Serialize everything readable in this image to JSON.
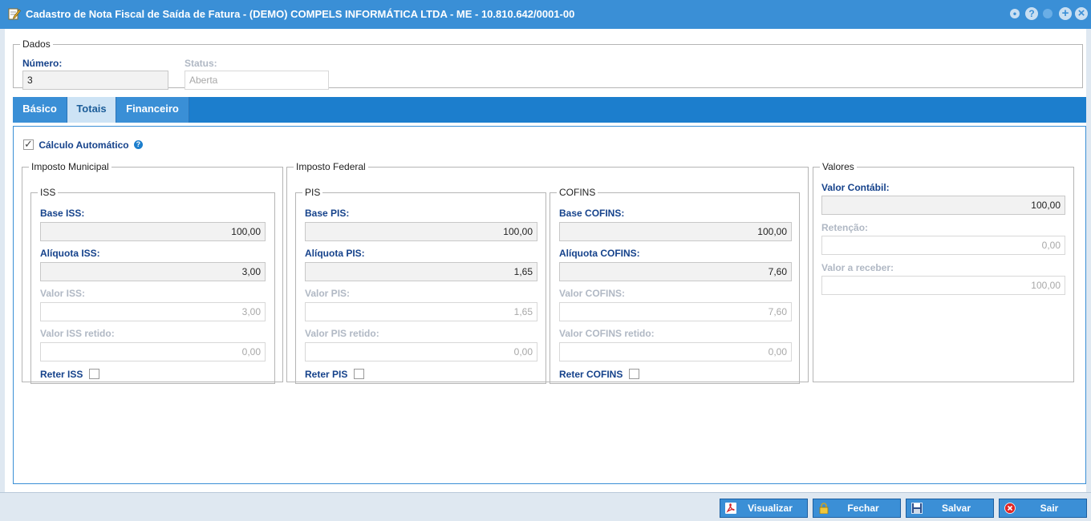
{
  "window": {
    "title": "Cadastro de Nota Fiscal de Saída de Fatura - (DEMO) COMPELS INFORMÁTICA LTDA - ME - 10.810.642/0001-00",
    "buttons": {
      "minimize": "•",
      "help": "?",
      "maximize": "+",
      "close": "×"
    }
  },
  "dados": {
    "legend": "Dados",
    "numero_label": "Número:",
    "numero_value": "3",
    "status_label": "Status:",
    "status_value": "Aberta"
  },
  "tabs": [
    {
      "label": "Básico",
      "active": false
    },
    {
      "label": "Totais",
      "active": true
    },
    {
      "label": "Financeiro",
      "active": false
    }
  ],
  "calculo": {
    "label": "Cálculo Automático",
    "checked": true,
    "help_icon": "?"
  },
  "imposto_municipal": {
    "legend": "Imposto Municipal",
    "iss": {
      "legend": "ISS",
      "base_label": "Base ISS:",
      "base_value": "100,00",
      "aliquota_label": "Alíquota ISS:",
      "aliquota_value": "3,00",
      "valor_label": "Valor ISS:",
      "valor_value": "3,00",
      "retido_label": "Valor ISS retido:",
      "retido_value": "0,00",
      "reter_label": "Reter ISS",
      "reter_checked": false
    }
  },
  "imposto_federal": {
    "legend": "Imposto Federal",
    "pis": {
      "legend": "PIS",
      "base_label": "Base PIS:",
      "base_value": "100,00",
      "aliquota_label": "Alíquota PIS:",
      "aliquota_value": "1,65",
      "valor_label": "Valor PIS:",
      "valor_value": "1,65",
      "retido_label": "Valor PIS retido:",
      "retido_value": "0,00",
      "reter_label": "Reter PIS",
      "reter_checked": false
    },
    "cofins": {
      "legend": "COFINS",
      "base_label": "Base COFINS:",
      "base_value": "100,00",
      "aliquota_label": "Alíquota COFINS:",
      "aliquota_value": "7,60",
      "valor_label": "Valor COFINS:",
      "valor_value": "7,60",
      "retido_label": "Valor COFINS retido:",
      "retido_value": "0,00",
      "reter_label": "Reter COFINS",
      "reter_checked": false
    }
  },
  "valores": {
    "legend": "Valores",
    "contabil_label": "Valor Contábil:",
    "contabil_value": "100,00",
    "retencao_label": "Retenção:",
    "retencao_value": "0,00",
    "receber_label": "Valor a receber:",
    "receber_value": "100,00"
  },
  "footer": {
    "visualizar": "Visualizar",
    "fechar": "Fechar",
    "salvar": "Salvar",
    "sair": "Sair"
  },
  "icons": {
    "title": "edit-note-icon",
    "visualizar": "pdf-icon",
    "fechar": "lock-icon",
    "salvar": "floppy-disk-icon",
    "sair": "exit-icon"
  },
  "colors": {
    "titlebar": "#3a8fd6",
    "label_blue": "#15428b",
    "tab_active": "#cde3f5",
    "button": "#3b8fd6"
  }
}
